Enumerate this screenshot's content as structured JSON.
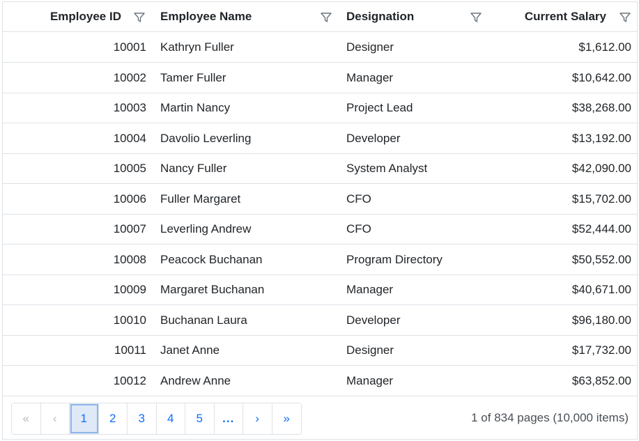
{
  "columns": {
    "id": "Employee ID",
    "name": "Employee Name",
    "designation": "Designation",
    "salary": "Current Salary"
  },
  "rows": [
    {
      "id": "10001",
      "name": "Kathryn Fuller",
      "designation": "Designer",
      "salary": "$1,612.00"
    },
    {
      "id": "10002",
      "name": "Tamer Fuller",
      "designation": "Manager",
      "salary": "$10,642.00"
    },
    {
      "id": "10003",
      "name": "Martin Nancy",
      "designation": "Project Lead",
      "salary": "$38,268.00"
    },
    {
      "id": "10004",
      "name": "Davolio Leverling",
      "designation": "Developer",
      "salary": "$13,192.00"
    },
    {
      "id": "10005",
      "name": "Nancy Fuller",
      "designation": "System Analyst",
      "salary": "$42,090.00"
    },
    {
      "id": "10006",
      "name": "Fuller Margaret",
      "designation": "CFO",
      "salary": "$15,702.00"
    },
    {
      "id": "10007",
      "name": "Leverling Andrew",
      "designation": "CFO",
      "salary": "$52,444.00"
    },
    {
      "id": "10008",
      "name": "Peacock Buchanan",
      "designation": "Program Directory",
      "salary": "$50,552.00"
    },
    {
      "id": "10009",
      "name": "Margaret Buchanan",
      "designation": "Manager",
      "salary": "$40,671.00"
    },
    {
      "id": "10010",
      "name": "Buchanan Laura",
      "designation": "Developer",
      "salary": "$96,180.00"
    },
    {
      "id": "10011",
      "name": "Janet Anne",
      "designation": "Designer",
      "salary": "$17,732.00"
    },
    {
      "id": "10012",
      "name": "Andrew Anne",
      "designation": "Manager",
      "salary": "$63,852.00"
    }
  ],
  "pager": {
    "first": "«",
    "prev": "‹",
    "pages": [
      "1",
      "2",
      "3",
      "4",
      "5"
    ],
    "current": "1",
    "more": "...",
    "next": "›",
    "last": "»",
    "info": "1 of 834 pages (10,000 items)"
  },
  "icons": {
    "filter": "filter-icon"
  },
  "colors": {
    "link": "#0d6efd",
    "border": "#dee2e6",
    "active_bg": "#dfe9f7"
  }
}
